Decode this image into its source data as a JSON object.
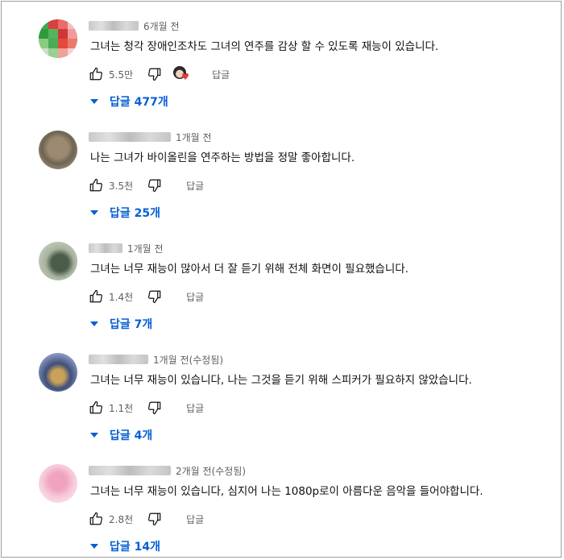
{
  "comments": [
    {
      "time": "6개월 전",
      "text": "그녀는 청각 장애인조차도 그녀의 연주를 감상 할 수 있도록 재능이 있습니다.",
      "likes": "5.5만",
      "reply_label": "답글",
      "replies_label": "답글 477개",
      "has_creator_heart": true
    },
    {
      "time": "1개월 전",
      "text": "나는 그녀가 바이올린을 연주하는 방법을 정말 좋아합니다.",
      "likes": "3.5천",
      "reply_label": "답글",
      "replies_label": "답글 25개"
    },
    {
      "time": "1개월 전",
      "text": "그녀는 너무 재능이 많아서 더 잘 듣기 위해 전체 화면이 필요했습니다.",
      "likes": "1.4천",
      "reply_label": "답글",
      "replies_label": "답글 7개"
    },
    {
      "time": "1개월 전(수정됨)",
      "text": "그녀는 너무 재능이 있습니다, 나는 그것을 듣기 위해 스피커가 필요하지 않았습니다.",
      "likes": "1.1천",
      "reply_label": "답글",
      "replies_label": "답글 4개"
    },
    {
      "time": "2개월 전(수정됨)",
      "text": "그녀는 너무 재능이 있습니다, 심지어 나는 1080p로이 아름다운 음악을 들어야합니다.",
      "likes": "2.8천",
      "reply_label": "답글",
      "replies_label": "답글 14개"
    }
  ],
  "icons": {
    "like": "thumbs-up-icon",
    "dislike": "thumbs-down-icon",
    "expand": "caret-down-icon",
    "creator_heart": "creator-heart-icon"
  },
  "colors": {
    "link_blue": "#065fd4",
    "meta_gray": "#606060",
    "text": "#0f0f0f",
    "heart_red": "#e53935"
  }
}
